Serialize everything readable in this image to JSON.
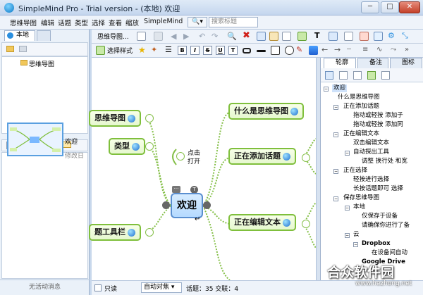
{
  "window": {
    "title": "SimpleMind Pro - Trial version - (本地) 欢迎",
    "minimize": "─",
    "maximize": "□",
    "close": "✕"
  },
  "menu": {
    "items": [
      "思维导图",
      "编辑",
      "话题",
      "类型",
      "选择",
      "查看",
      "缩放",
      "SimpleMind"
    ],
    "search_placeholder": "搜索标题",
    "search_btn": "🔍▾"
  },
  "left_panel": {
    "tab_local": "本地",
    "tree_item": "思维导图",
    "thumb_name": "欢迎",
    "thumb_modified": "修改日",
    "status": "无活动消息"
  },
  "toolbar": {
    "mindmap_menu": "思维导图...",
    "select_style": "选择样式",
    "fmt": [
      "B",
      "I",
      "S",
      "U",
      "T"
    ]
  },
  "canvas": {
    "central": "欢迎",
    "nodes": {
      "what": "什么是思维导图",
      "adding": "正在添加话题",
      "editing": "正在编辑文本",
      "left_top": "思维导图",
      "type": "类型",
      "left_bottom": "题工具栏"
    },
    "callout": {
      "line1": "点击",
      "line2": "打开"
    }
  },
  "right_panel": {
    "tabs": {
      "outline": "轮廓",
      "notes": "备注",
      "icons": "图标"
    },
    "outline": [
      "欢迎",
      "什么是思维导图",
      "正在添加话题",
      "拖动或轻按 添加子",
      "拖动或轻按 添加同",
      "正在编辑文本",
      "双击编辑文本",
      "自动探出工具",
      "调整 换行处 和宽",
      "正在选择",
      "轻按进行选择",
      "长按话题即可 选择",
      "保存思维导图",
      "本地",
      "仅保存于设备",
      "请确保你进行了备",
      "云",
      "Dropbox",
      "在设备间自动",
      "Google Drive"
    ]
  },
  "statusbar": {
    "readonly": "只读",
    "auto_focus": "自动对焦 ▾",
    "counts": "话题：35  交联：4"
  },
  "watermark": {
    "text": "合众软件园",
    "url": "www.hezhong.net"
  }
}
